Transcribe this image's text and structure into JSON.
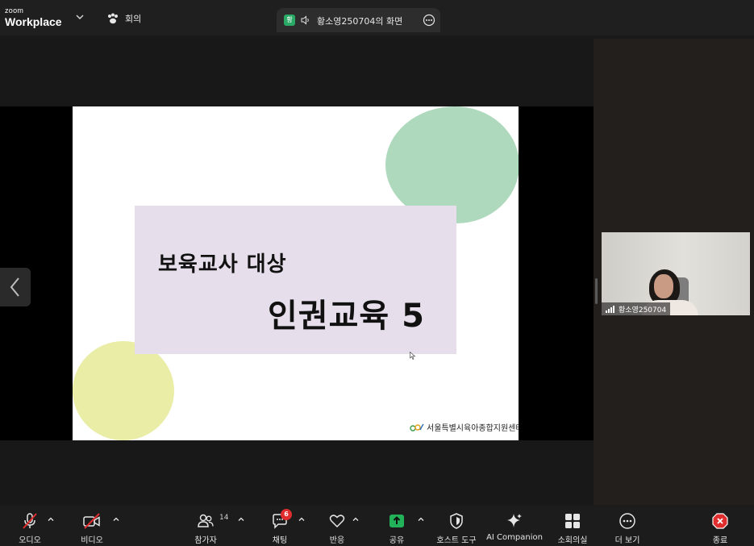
{
  "app": {
    "brand_line1": "zoom",
    "brand_line2": "Workplace",
    "meeting_label": "회의"
  },
  "share": {
    "avatar_initial": "황",
    "title": "황소영250704의 화면"
  },
  "slide": {
    "line1": "보육교사 대상",
    "line2": "인권교육 5",
    "org_name": "서울특별시육아종합지원센터",
    "colors": {
      "green_blob": "#aed9bd",
      "yellow_blob": "#e9eda6",
      "card": "#e6dfeb"
    }
  },
  "participant": {
    "name": "황소영250704"
  },
  "toolbar": {
    "audio": "오디오",
    "video": "비디오",
    "participants": "참가자",
    "participants_count": "14",
    "chat": "채팅",
    "chat_badge": "6",
    "reactions": "반응",
    "share": "공유",
    "host_tools": "호스트 도구",
    "ai_companion": "AI Companion",
    "breakout": "소회의실",
    "more": "더 보기",
    "end": "종료"
  },
  "colors": {
    "share_green": "#22b35a",
    "end_red": "#e02e2e",
    "muted_red": "#e02e2e"
  }
}
